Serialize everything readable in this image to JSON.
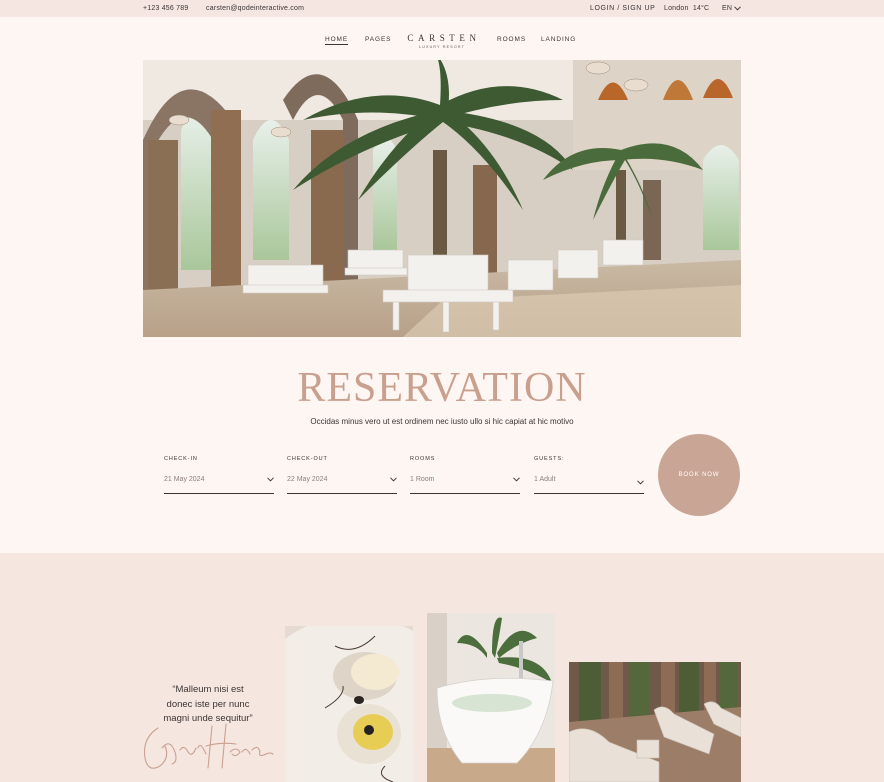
{
  "topbar": {
    "phone": "+123 456 789",
    "email": "carsten@qodeinteractive.com",
    "login": "LOGIN / SIGN UP",
    "city": "London",
    "temperature": "14°C",
    "language": "EN"
  },
  "nav": {
    "items": [
      "HOME",
      "PAGES",
      "ROOMS",
      "LANDING"
    ],
    "active": "HOME",
    "logo_name": "CARSTEN",
    "logo_sub": "LUXURY RESORT"
  },
  "reservation": {
    "title": "RESERVATION",
    "subtitle": "Occidas minus vero ut est ordinem nec iusto ullo si hic capiat at hic motivo",
    "fields": [
      {
        "label": "CHECK-IN",
        "value": "21 May 2024"
      },
      {
        "label": "CHECK-OUT",
        "value": "22 May 2024"
      },
      {
        "label": "ROOMS",
        "value": "1 Room"
      },
      {
        "label": "GUESTS:",
        "value": "1 Adult"
      }
    ],
    "book_label": "BOOK NOW"
  },
  "about": {
    "quote": "“Malleum nisi est donec iste per nunc magni unde sequitur”"
  },
  "colors": {
    "accent": "#c9a08e",
    "button": "#c9a596",
    "page_bg": "#fdf6f3",
    "section_bg": "#f6e6e0"
  },
  "icons": [
    "chevron-down-icon"
  ]
}
